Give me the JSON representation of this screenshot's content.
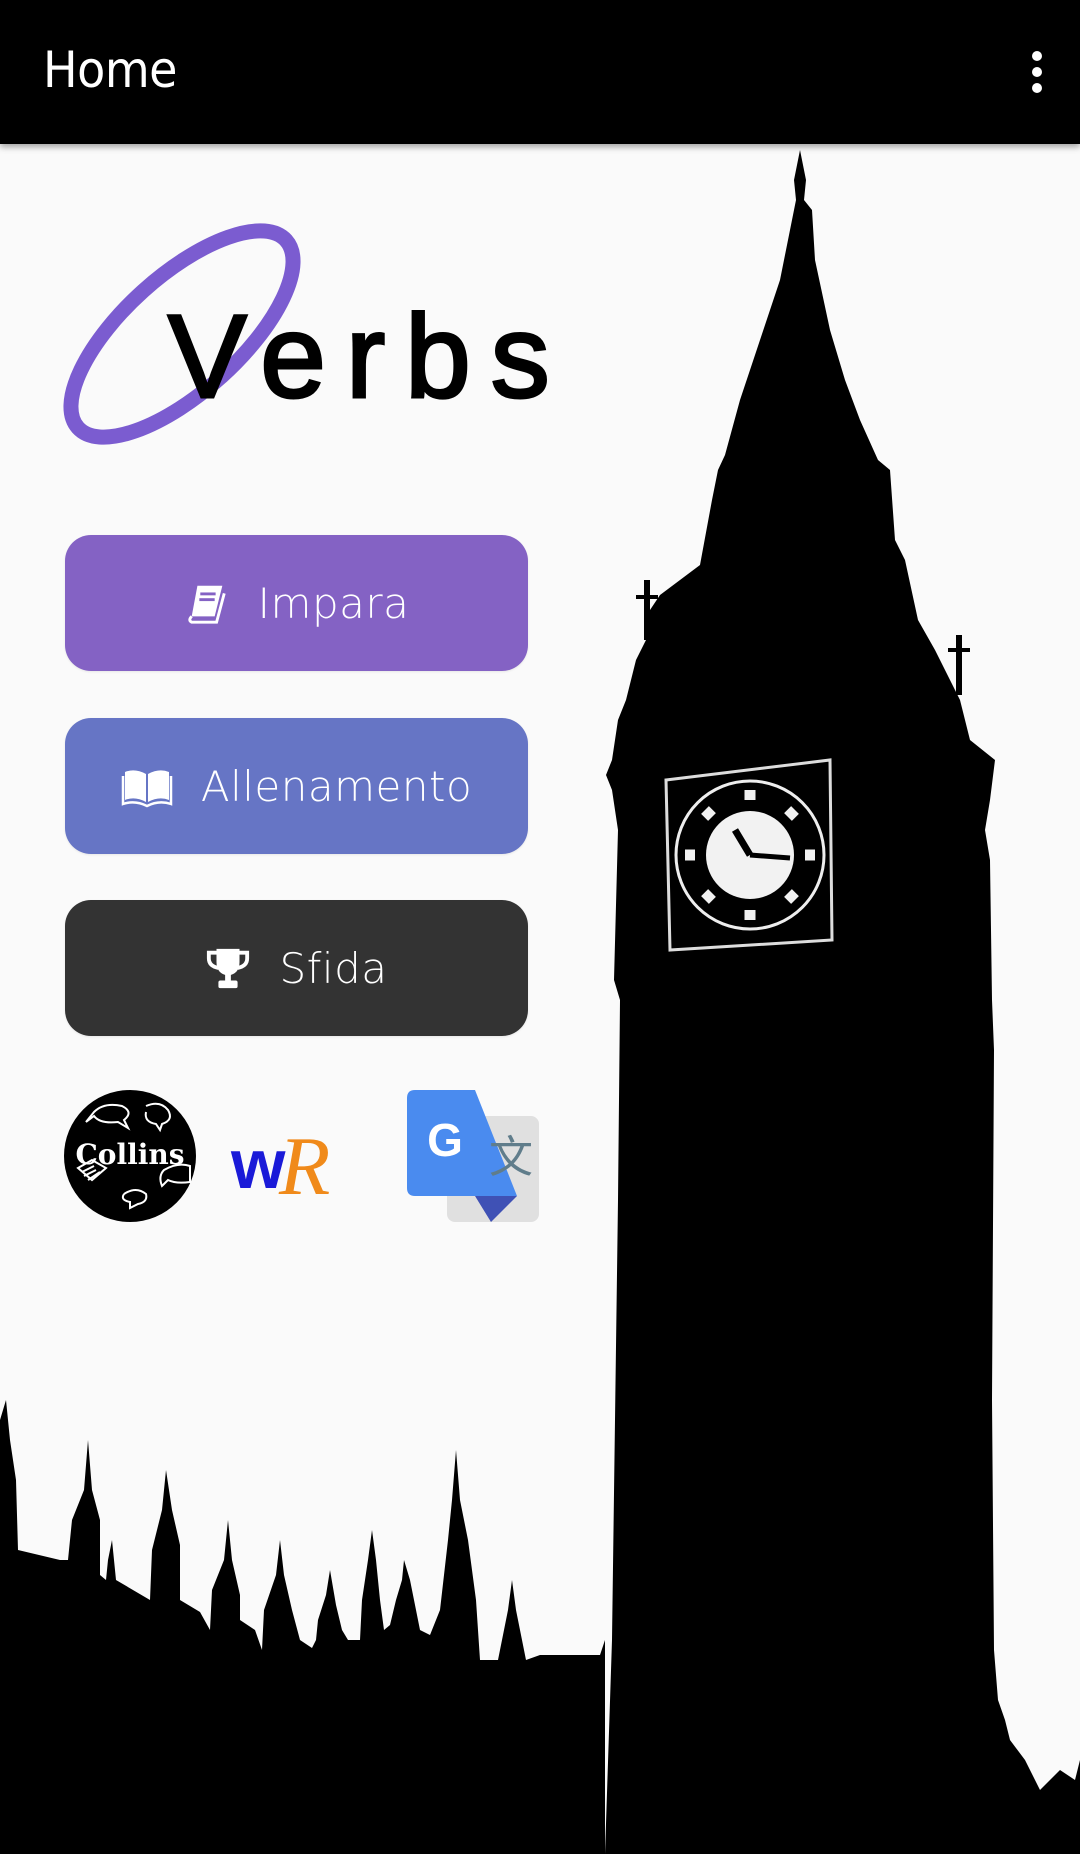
{
  "app_bar": {
    "title": "Home",
    "overflow_icon": "more-vert-icon"
  },
  "logo": {
    "text": "Verbs",
    "ring_color": "#7b5cd0"
  },
  "buttons": [
    {
      "label": "Impara",
      "icon": "book-icon",
      "color": "#8462c4"
    },
    {
      "label": "Allenamento",
      "icon": "open-book-icon",
      "color": "#6675c5"
    },
    {
      "label": "Sfida",
      "icon": "trophy-icon",
      "color": "#333333"
    }
  ],
  "dictionaries": [
    {
      "name": "Collins",
      "icon": "collins-logo"
    },
    {
      "name": "WordReference",
      "icon": "wordreference-logo",
      "mark_w": "w",
      "mark_r": "R"
    },
    {
      "name": "Google Translate",
      "icon": "google-translate-logo",
      "mark_g": "G",
      "mark_zh": "文"
    }
  ],
  "background": {
    "subject": "Big Ben and Houses of Parliament silhouette"
  }
}
